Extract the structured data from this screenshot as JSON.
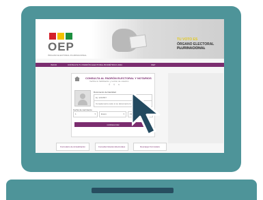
{
  "header": {
    "logo_text": "OEP",
    "logo_subtitle": "ÓRGANO ELECTORAL PLURINACIONAL",
    "flag_colors": [
      "#d4202a",
      "#f2c200",
      "#1d8f3f"
    ],
    "hero_title_1": "TU VOTO ES",
    "hero_title_2": "ÓRGANO ELECTORAL PLURINACIONAL",
    "hero_title_3": "Estado Plurinacional de Bolivia"
  },
  "nav": {
    "items": [
      "INICIO",
      "CONSULTA TU PADRÓN ELECTORAL BIOMÉTRICO 2024",
      "OEP"
    ]
  },
  "form": {
    "title": "CONSULTA AL PADRÓN ELECTORAL Y NOTARIOS",
    "subtitle": "Verifica tu habilitación y recinto de votación",
    "id_label": "Documento de Identidad",
    "id_placeholder": "Ej: 1234567",
    "complement_placeholder": "Complemento (solo si su documento lo tiene)",
    "birthdate_label": "Fecha de nacimiento",
    "day_value": "1",
    "month_value": "Enero",
    "year_value": "1990",
    "submit_label": "CONSULTAR"
  },
  "bottom_buttons": [
    "Formulario de Actualización",
    "Consulta Notarios Electorales",
    "Descargar Formulario"
  ],
  "colors": {
    "brand": "#7b2d6f",
    "laptop_frame": "#4e9499",
    "trackpad": "#274e60",
    "cursor": "#234a60"
  }
}
